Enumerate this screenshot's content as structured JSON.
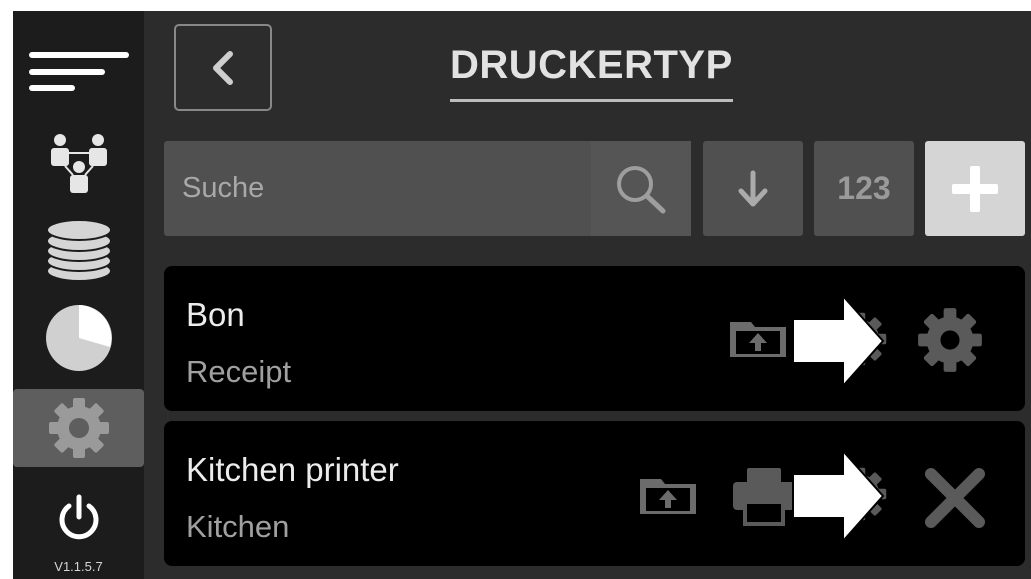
{
  "sidebar": {
    "items": [
      {
        "icon": "menu-icon"
      },
      {
        "icon": "users-network-icon"
      },
      {
        "icon": "database-icon"
      },
      {
        "icon": "pie-chart-icon"
      },
      {
        "icon": "gear-icon",
        "active": true
      },
      {
        "icon": "power-icon"
      }
    ],
    "version": "V1.1.5.7"
  },
  "header": {
    "title": "DRUCKERTYP",
    "back_icon": "chevron-left-icon"
  },
  "toolbar": {
    "search_placeholder": "Suche",
    "search_icon": "search-icon",
    "sort_icon": "arrow-down-icon",
    "numeric_label": "123",
    "add_icon": "plus-icon"
  },
  "printer_types": [
    {
      "name": "Bon",
      "type": "Receipt",
      "actions": [
        "folder-upload-icon",
        "gear-icon",
        "gear-icon"
      ]
    },
    {
      "name": "Kitchen printer",
      "type": "Kitchen",
      "actions": [
        "folder-upload-icon",
        "printer-icon",
        "gear-icon",
        "close-icon"
      ]
    }
  ],
  "colors": {
    "screen_bg": "#2c2c2c",
    "sidebar_bg": "#1c1c1c",
    "active_item": "#5e5e5e",
    "card_bg": "#000000",
    "add_button": "#d5d5d5"
  }
}
